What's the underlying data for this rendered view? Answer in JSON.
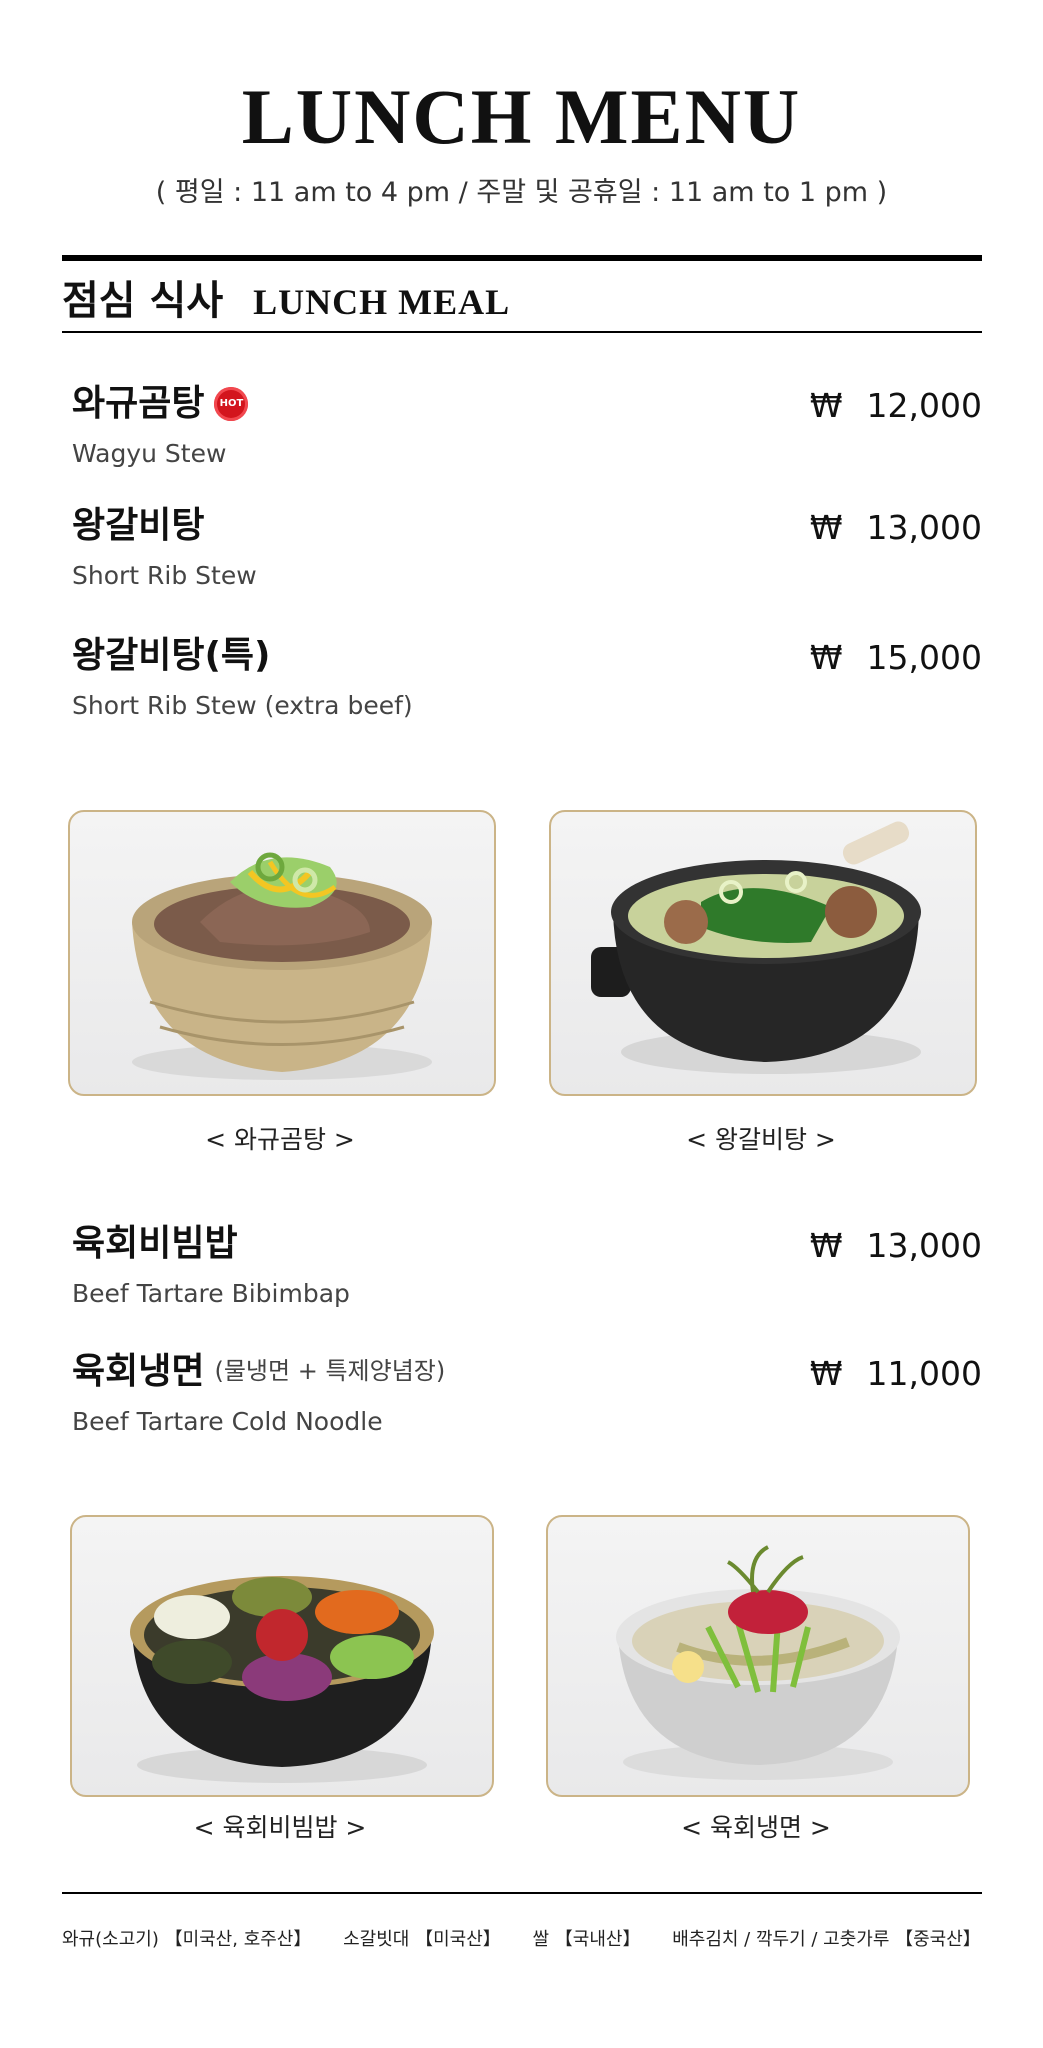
{
  "header": {
    "title": "LUNCH MENU",
    "hours": "( 평일 : 11 am to 4 pm / 주말 및 공휴일 : 11 am to 1 pm )"
  },
  "section": {
    "title_ko": "점심 식사",
    "title_en": "LUNCH MEAL"
  },
  "currency": "₩",
  "items": [
    {
      "name_ko": "와규곰탕",
      "badge": "HOT",
      "name_en": "Wagyu Stew",
      "price": "12,000"
    },
    {
      "name_ko": "왕갈비탕",
      "name_en": "Short Rib Stew",
      "price": "13,000"
    },
    {
      "name_ko": "왕갈비탕(특)",
      "name_en": "Short Rib Stew (extra beef)",
      "price": "15,000"
    },
    {
      "name_ko": "육회비빔밥",
      "name_en": "Beef Tartare Bibimbap",
      "price": "13,000"
    },
    {
      "name_ko": "육회냉면",
      "note": "(물냉면 + 특제양념장)",
      "name_en": "Beef Tartare Cold Noodle",
      "price": "11,000"
    }
  ],
  "photos": [
    {
      "caption": "< 와규곰탕 >",
      "icon": "wagyu-stew-photo"
    },
    {
      "caption": "< 왕갈비탕 >",
      "icon": "short-rib-stew-photo"
    },
    {
      "caption": "< 육회비빔밥 >",
      "icon": "bibimbap-photo"
    },
    {
      "caption": "< 육회냉면 >",
      "icon": "cold-noodle-photo"
    }
  ],
  "origin": [
    "와규(소고기) 【미국산, 호주산】",
    "소갈빗대 【미국산】",
    "쌀 【국내산】",
    "배추김치 / 깍두기 / 고춧가루 【중국산】"
  ],
  "colors": {
    "photo_border": "#cbb487",
    "hot_badge": "#d3151d"
  }
}
